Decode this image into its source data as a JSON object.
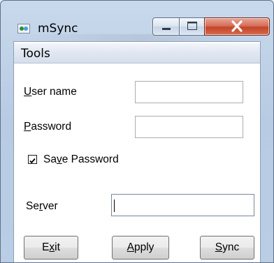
{
  "window": {
    "title": "mSync",
    "icon": "app-sync-icon",
    "controls": {
      "minimize": "minimize-icon",
      "maximize": "maximize-icon",
      "close": "close-icon"
    },
    "close_color": "#c2452b"
  },
  "menu": {
    "items": [
      {
        "label": "Tools"
      }
    ]
  },
  "form": {
    "username": {
      "label_first": "U",
      "label_rest": "ser name",
      "value": ""
    },
    "password": {
      "label_first": "P",
      "label_rest": "assword",
      "value": ""
    },
    "save_password": {
      "label_pre": "Sa",
      "label_mnemonic": "v",
      "label_post": "e Password",
      "checked": true
    },
    "server": {
      "label_pre": "Se",
      "label_mnemonic": "r",
      "label_post": "ver",
      "value": ""
    }
  },
  "buttons": {
    "exit": {
      "pre": "E",
      "mnemonic": "x",
      "post": "it"
    },
    "apply": {
      "pre": "",
      "mnemonic": "A",
      "post": "pply"
    },
    "sync": {
      "pre": "",
      "mnemonic": "S",
      "post": "ync"
    }
  }
}
